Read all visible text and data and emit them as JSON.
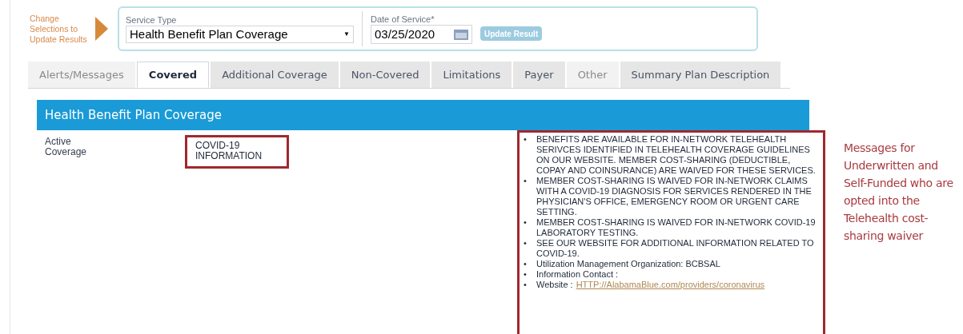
{
  "prompt": {
    "arrow_label": "Change Selections to Update Results"
  },
  "service_type": {
    "label": "Service Type",
    "value": "Health Benefit Plan Coverage",
    "caret": "▼"
  },
  "date_of_service": {
    "label": "Date of Service*",
    "value": "03/25/2020"
  },
  "update_button": {
    "label": "Update Result",
    "disabled": true
  },
  "tabs": [
    {
      "label": "Alerts/Messages",
      "selected": false,
      "disabled": true
    },
    {
      "label": "Covered",
      "selected": true,
      "disabled": false
    },
    {
      "label": "Additional Coverage",
      "selected": false,
      "disabled": false
    },
    {
      "label": "Non-Covered",
      "selected": false,
      "disabled": false
    },
    {
      "label": "Limitations",
      "selected": false,
      "disabled": false
    },
    {
      "label": "Payer",
      "selected": false,
      "disabled": false
    },
    {
      "label": "Other",
      "selected": false,
      "disabled": true
    },
    {
      "label": "Summary Plan Description",
      "selected": false,
      "disabled": false
    }
  ],
  "section": {
    "title": "Health Benefit Plan Coverage",
    "row": {
      "label": "Active Coverage",
      "value": "COVID-19 INFORMATION",
      "messages": [
        {
          "kind": "text",
          "bullet": "•",
          "text": "BENEFITS ARE AVAILABLE FOR IN-NETWORK TELEHEALTH SERIVCES IDENTIFIED IN TELEHEALTH COVERAGE GUIDELINES ON OUR WEBSITE. MEMBER COST-SHARING (DEDUCTIBLE, COPAY AND COINSURANCE) ARE WAIVED FOR THESE SERVICES."
        },
        {
          "kind": "text",
          "bullet": "•",
          "text": "MEMBER COST-SHARING IS WAIVED FOR IN-NETWORK CLAIMS WITH A COVID-19 DIAGNOSIS FOR SERVICES RENDERED IN THE PHYSICIAN'S OFFICE, EMERGENCY ROOM OR URGENT CARE SETTING."
        },
        {
          "kind": "text",
          "bullet": "•",
          "text": "MEMBER COST-SHARING IS WAIVED FOR IN-NETWORK COVID-19 LABORATORY TESTING."
        },
        {
          "kind": "text",
          "bullet": "•",
          "text": "SEE OUR WEBSITE FOR ADDITIONAL INFORMATION RELATED TO COVID-19."
        },
        {
          "kind": "field",
          "bullet": "•",
          "text": "Utilization Management Organization: BCBSAL"
        },
        {
          "kind": "field",
          "bullet": "•",
          "text": "Information Contact :"
        },
        {
          "kind": "link",
          "bullet": "•",
          "text": "Website :",
          "link": "HTTP://AlabamaBlue.com/providers/coronavirus"
        }
      ]
    }
  },
  "annotation": "Messages for Underwritten and Self-Funded who are opted into the Telehealth cost-sharing waiver"
}
